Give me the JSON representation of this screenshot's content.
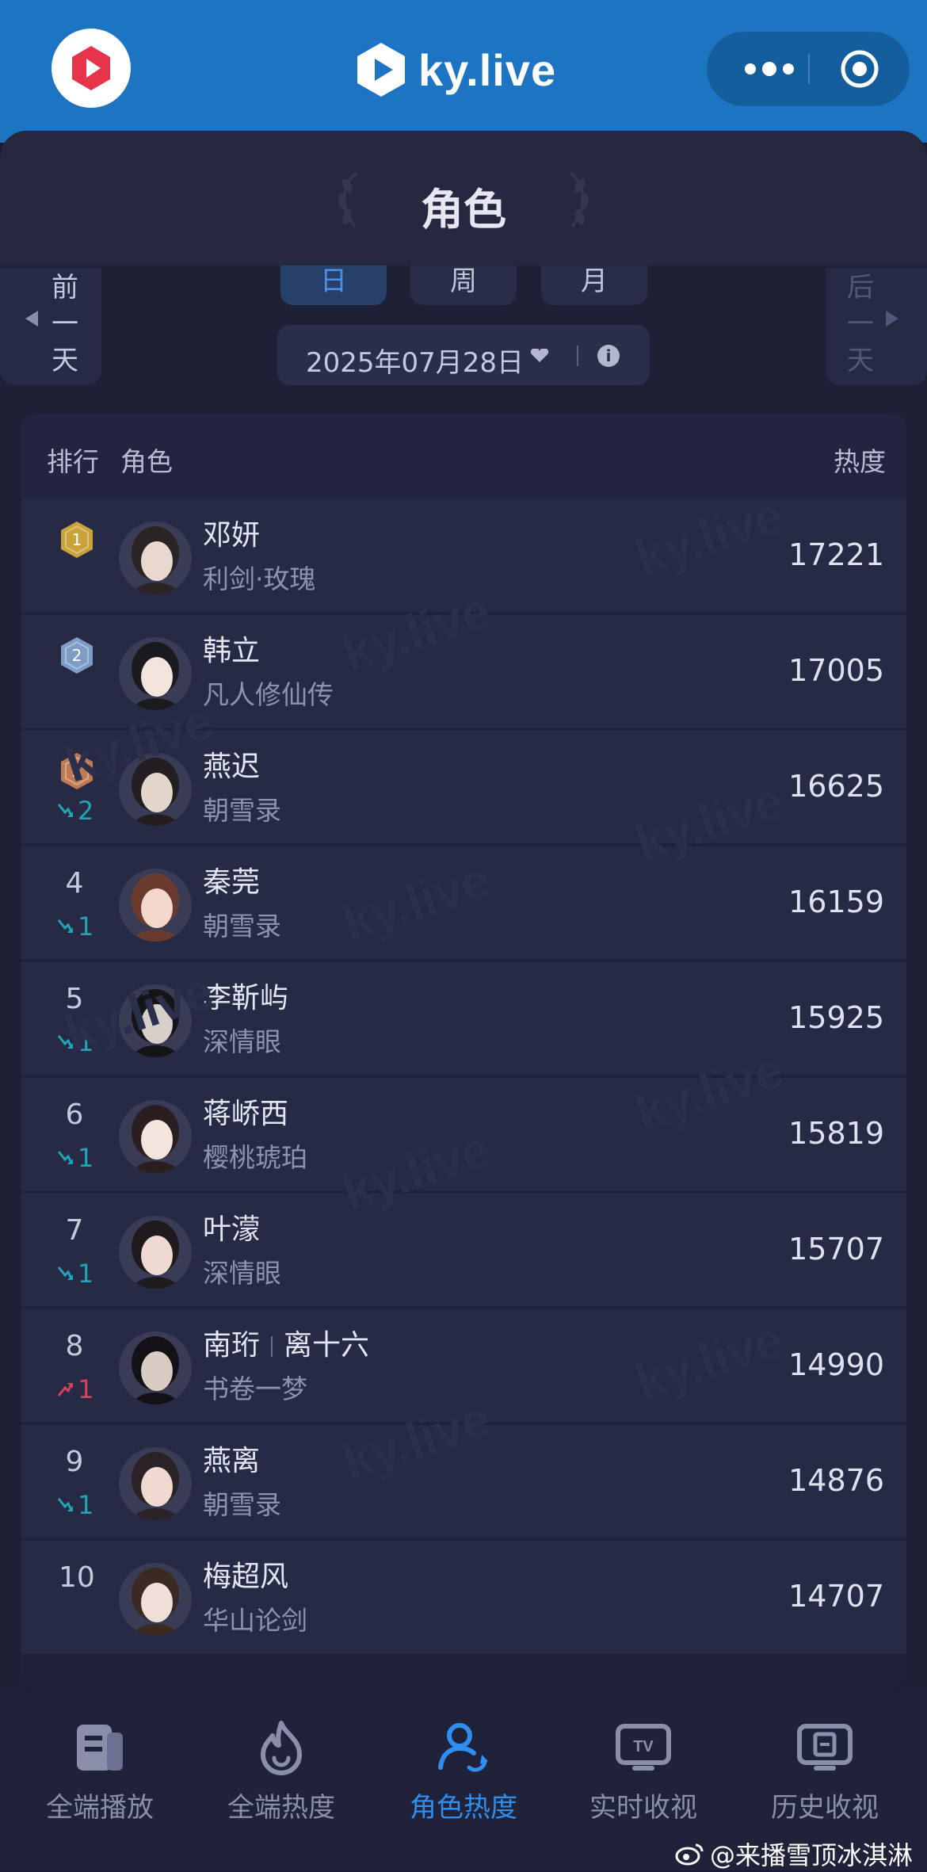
{
  "header": {
    "brand": "ky.live"
  },
  "page": {
    "title": "角色"
  },
  "period_tabs": [
    "日",
    "周",
    "月"
  ],
  "active_tab": "日",
  "date_picker": {
    "value": "2025年07月28日"
  },
  "nav_buttons": {
    "prev_day": [
      "前",
      "一",
      "天"
    ],
    "next_day": [
      "后",
      "一",
      "天"
    ]
  },
  "table": {
    "headers": {
      "rank": "排行",
      "role": "角色",
      "heat": "热度"
    },
    "rows": [
      {
        "rank": "1",
        "name": "邓妍",
        "name2": "",
        "drama": "利剑·玫瑰",
        "heat": "17221",
        "trend_dir": "",
        "trend_val": ""
      },
      {
        "rank": "2",
        "name": "韩立",
        "name2": "",
        "drama": "凡人修仙传",
        "heat": "17005",
        "trend_dir": "",
        "trend_val": ""
      },
      {
        "rank": "3",
        "name": "燕迟",
        "name2": "",
        "drama": "朝雪录",
        "heat": "16625",
        "trend_dir": "down",
        "trend_val": "2"
      },
      {
        "rank": "4",
        "name": "秦莞",
        "name2": "",
        "drama": "朝雪录",
        "heat": "16159",
        "trend_dir": "down",
        "trend_val": "1"
      },
      {
        "rank": "5",
        "name": "李靳屿",
        "name2": "",
        "drama": "深情眼",
        "heat": "15925",
        "trend_dir": "down",
        "trend_val": "1"
      },
      {
        "rank": "6",
        "name": "蒋峤西",
        "name2": "",
        "drama": "樱桃琥珀",
        "heat": "15819",
        "trend_dir": "down",
        "trend_val": "1"
      },
      {
        "rank": "7",
        "name": "叶濛",
        "name2": "",
        "drama": "深情眼",
        "heat": "15707",
        "trend_dir": "down",
        "trend_val": "1"
      },
      {
        "rank": "8",
        "name": "南珩",
        "name2": "离十六",
        "drama": "书卷一梦",
        "heat": "14990",
        "trend_dir": "up",
        "trend_val": "1"
      },
      {
        "rank": "9",
        "name": "燕离",
        "name2": "",
        "drama": "朝雪录",
        "heat": "14876",
        "trend_dir": "down",
        "trend_val": "1"
      },
      {
        "rank": "10",
        "name": "梅超风",
        "name2": "",
        "drama": "华山论剑",
        "heat": "14707",
        "trend_dir": "",
        "trend_val": ""
      }
    ]
  },
  "bottom_nav": [
    {
      "label": "全端播放",
      "icon": "play-stats-icon"
    },
    {
      "label": "全端热度",
      "icon": "flame-icon"
    },
    {
      "label": "角色热度",
      "icon": "person-icon",
      "active": true
    },
    {
      "label": "实时收视",
      "icon": "tv-icon"
    },
    {
      "label": "历史收视",
      "icon": "history-tv-icon"
    }
  ],
  "watermark_credit": "@来播雪顶冰淇淋",
  "colors": {
    "header_bg": "#1d74c3",
    "accent": "#2f8ef0",
    "trend_down": "#1ea5b7",
    "trend_up": "#d9405a",
    "gold": "#c9a23a",
    "silver": "#7e9cc6",
    "bronze": "#c07a52"
  }
}
